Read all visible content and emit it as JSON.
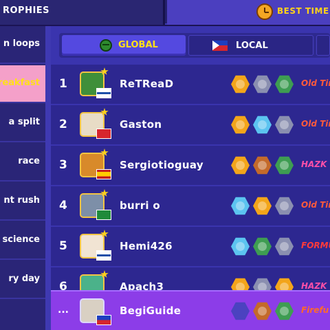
{
  "header": {
    "trophies_tab": "ROPHIES",
    "besttimes_tab": "BEST TIME"
  },
  "sidebar": {
    "items": [
      {
        "label": "n loops",
        "active": false
      },
      {
        "label": "reakfast",
        "active": true
      },
      {
        "label": "a split",
        "active": false
      },
      {
        "label": "race",
        "active": false
      },
      {
        "label": "nt rush",
        "active": false
      },
      {
        "label": "science",
        "active": false
      },
      {
        "label": "ry day",
        "active": false
      },
      {
        "label": "",
        "active": false
      }
    ]
  },
  "filters": {
    "global": "GLOBAL",
    "local": "LOCAL"
  },
  "leaderboard": [
    {
      "rank": "1",
      "name": "ReTReaD",
      "flag": "finland",
      "badges": [
        "gold",
        "silver",
        "green"
      ],
      "title": "Old Tim",
      "title_color": "#ff5a3c"
    },
    {
      "rank": "2",
      "name": "Gaston",
      "flag": "switzerland",
      "badges": [
        "gold",
        "blue",
        "silver"
      ],
      "title": "Old Tim",
      "title_color": "#ff5a3c"
    },
    {
      "rank": "3",
      "name": "Sergiotioguay",
      "flag": "spain",
      "badges": [
        "gold",
        "bronze",
        "green"
      ],
      "title": "HAZK",
      "title_color": "#ff4fa8"
    },
    {
      "rank": "4",
      "name": "burri o",
      "flag": "saudi-arabia",
      "badges": [
        "blue",
        "gold",
        "silver"
      ],
      "title": "Old Tim",
      "title_color": "#ff5a3c"
    },
    {
      "rank": "5",
      "name": "Hemi426",
      "flag": "finland",
      "badges": [
        "blue",
        "green",
        "silver"
      ],
      "title": "FORMUL",
      "title_color": "#ff3b3b"
    },
    {
      "rank": "6",
      "name": "Apach3",
      "flag": "none",
      "badges": [
        "gold",
        "silver",
        "gold"
      ],
      "title": "HAZK",
      "title_color": "#ff4fa8"
    }
  ],
  "player": {
    "rank": "...",
    "name": "BegiGuide",
    "flag": "philippines",
    "badges": [
      "empty",
      "bronze",
      "green"
    ],
    "title": "Firefu",
    "title_color": "#ff6a2a"
  },
  "colors": {
    "accent_yellow": "#ffe019",
    "row_bg": "#2d2790",
    "player_row_bg": "#8c3de8",
    "active_sidebar": "#f4a0c9"
  }
}
